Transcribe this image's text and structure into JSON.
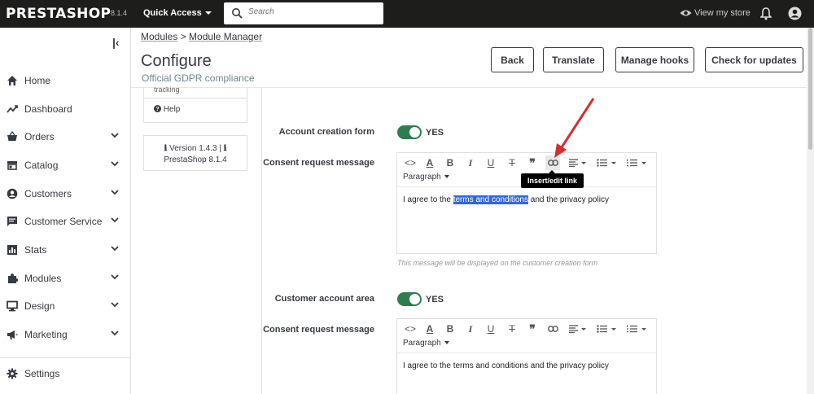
{
  "topbar": {
    "logo": "PRESTASHOP",
    "version": "8.1.4",
    "quick_access": "Quick Access",
    "search_placeholder": "Search",
    "view_store": "View my store"
  },
  "sidebar": {
    "items": [
      {
        "label": "Home",
        "icon": "home-icon",
        "chevron": false
      },
      {
        "label": "Dashboard",
        "icon": "trending-icon",
        "chevron": false
      },
      {
        "label": "Orders",
        "icon": "basket-icon",
        "chevron": true
      },
      {
        "label": "Catalog",
        "icon": "store-icon",
        "chevron": true
      },
      {
        "label": "Customers",
        "icon": "account-circle-icon",
        "chevron": true
      },
      {
        "label": "Customer Service",
        "icon": "chat-icon",
        "chevron": true
      },
      {
        "label": "Stats",
        "icon": "bar-chart-icon",
        "chevron": true
      },
      {
        "label": "Modules",
        "icon": "puzzle-icon",
        "chevron": true
      },
      {
        "label": "Design",
        "icon": "desktop-icon",
        "chevron": true
      },
      {
        "label": "Marketing",
        "icon": "megaphone-icon",
        "chevron": true
      },
      {
        "label": "Settings",
        "icon": "gear-icon",
        "chevron": false
      }
    ]
  },
  "header": {
    "breadcrumb_1": "Modules",
    "breadcrumb_sep": " > ",
    "breadcrumb_2": "Module Manager",
    "title": "Configure",
    "subtitle": "Official GDPR compliance",
    "buttons": {
      "back": "Back",
      "translate": "Translate",
      "manage_hooks": "Manage hooks",
      "check_updates": "Check for updates"
    }
  },
  "left_panel": {
    "tracking": "tracking",
    "help": "Help",
    "version_line1": "Version 1.4.3 |",
    "version_line2": "PrestaShop 8.1.4"
  },
  "form": {
    "account_creation_label": "Account creation form",
    "account_creation_value": "YES",
    "consent_label_1": "Consent request message",
    "editor1": {
      "paragraph": "Paragraph",
      "text_before": "I agree to the ",
      "text_highlight": "terms and conditions",
      "text_after": " and the privacy policy"
    },
    "editor1_help": "This message will be displayed on the customer creation form",
    "tooltip": "Insert/edit link",
    "customer_area_label": "Customer account area",
    "customer_area_value": "YES",
    "consent_label_2": "Consent request message",
    "editor2": {
      "paragraph": "Paragraph",
      "text": "I agree to the terms and conditions and the privacy policy"
    }
  },
  "colors": {
    "topbar": "#1d1d1b",
    "switch_on": "#2e7d4f",
    "selection": "#3367d6",
    "annotation_arrow": "#d32f2f"
  }
}
